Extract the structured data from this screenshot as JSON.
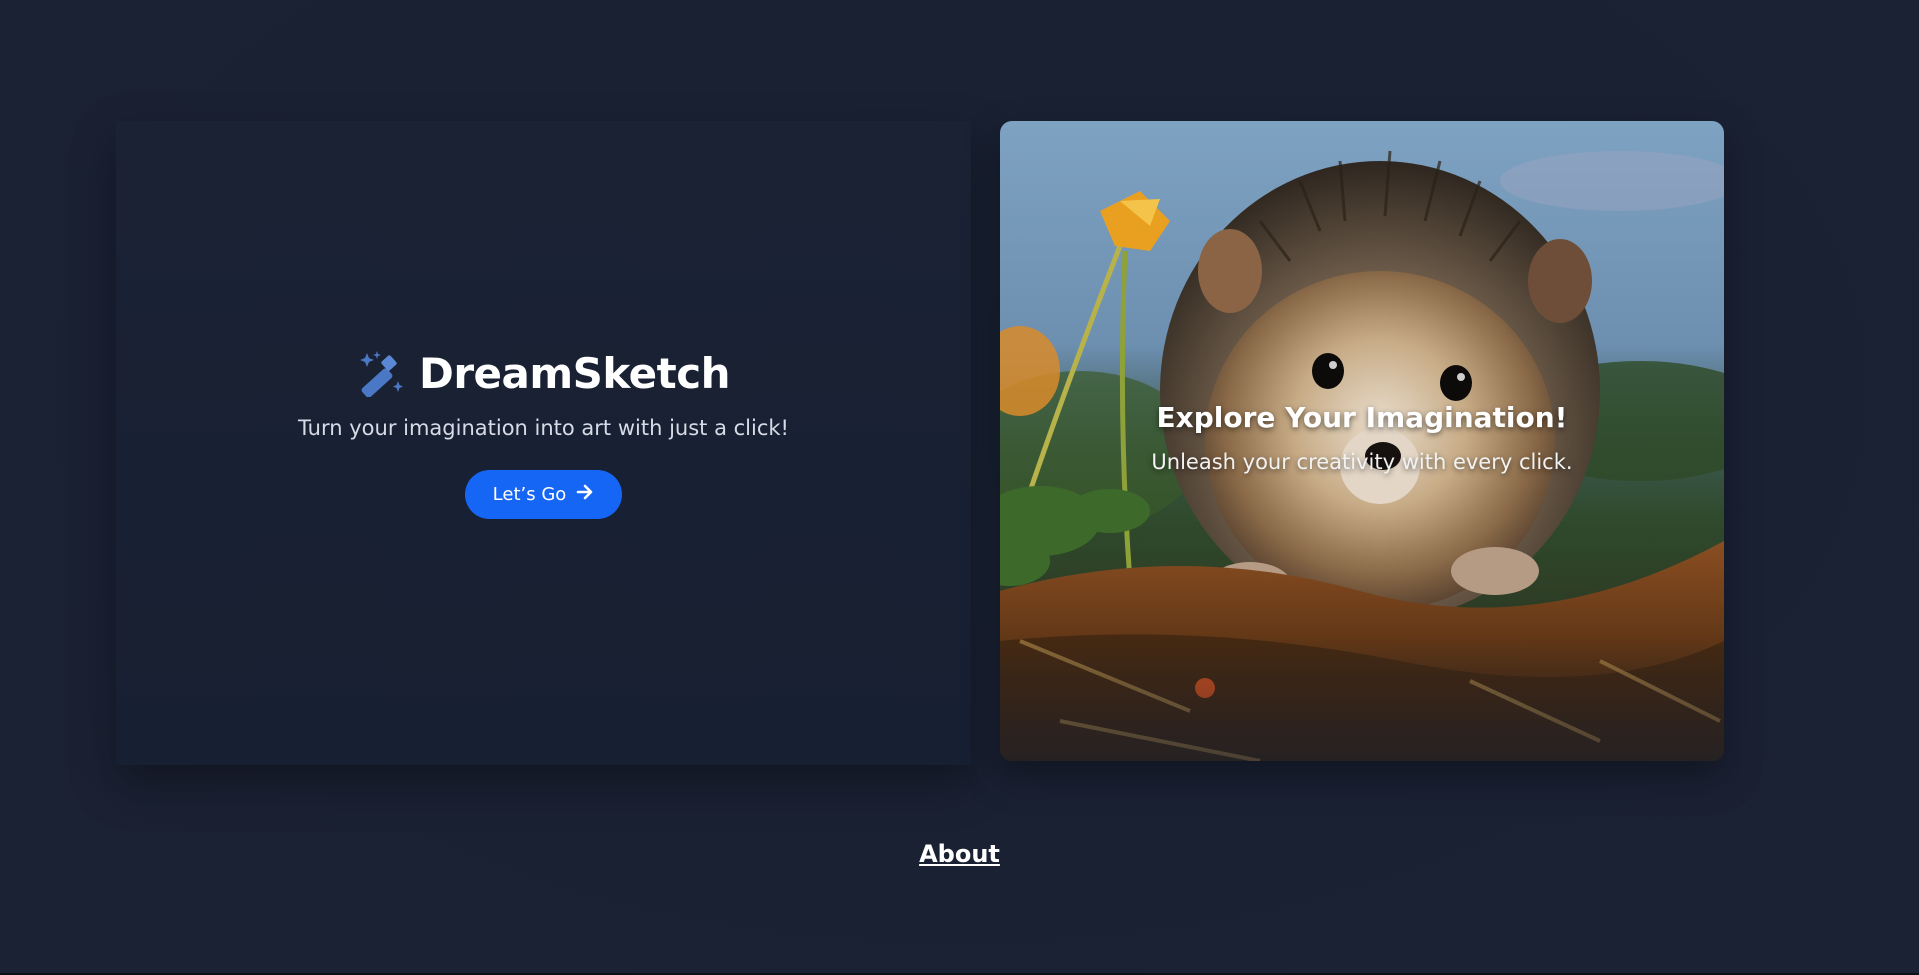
{
  "brand": {
    "title": "DreamSketch",
    "icon": "magic-wand-icon",
    "icon_color": "#4a78c4"
  },
  "hero_left": {
    "tagline": "Turn your imagination into art with just a click!",
    "cta_label": "Let’s Go",
    "cta_icon": "arrow-right-icon",
    "cta_color": "#1666f5"
  },
  "hero_card": {
    "heading": "Explore Your Imagination!",
    "subheading": "Unleash your creativity with every click.",
    "image_subject": "hedgehog-photo"
  },
  "footer": {
    "about_label": "About"
  },
  "colors": {
    "background": "#1b2233",
    "panel": "#182133",
    "text_primary": "#ffffff",
    "text_secondary": "#d6dbe6"
  }
}
